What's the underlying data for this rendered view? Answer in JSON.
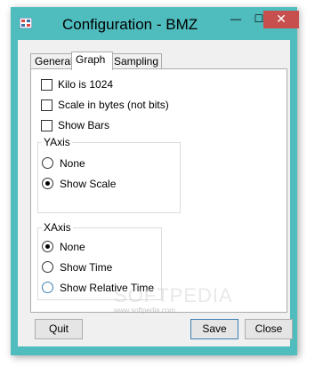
{
  "window": {
    "title": "Configuration - BMZ",
    "minimize_glyph": "—",
    "maximize_glyph": "☐",
    "close_glyph": "✕"
  },
  "tabs": [
    {
      "label": "General",
      "active": false
    },
    {
      "label": "Graph",
      "active": true
    },
    {
      "label": "Sampling",
      "active": false
    }
  ],
  "graph": {
    "checkboxes": [
      {
        "label": "Kilo is 1024",
        "checked": false
      },
      {
        "label": "Scale in bytes (not bits)",
        "checked": false
      },
      {
        "label": "Show Bars",
        "checked": false
      }
    ],
    "yaxis": {
      "title": "YAxis",
      "options": [
        {
          "label": "None",
          "checked": false
        },
        {
          "label": "Show Scale",
          "checked": true
        }
      ]
    },
    "xaxis": {
      "title": "XAxis",
      "options": [
        {
          "label": "None",
          "checked": true
        },
        {
          "label": "Show Time",
          "checked": false
        },
        {
          "label": "Show Relative Time",
          "checked": false
        }
      ]
    }
  },
  "buttons": {
    "quit": "Quit",
    "save": "Save",
    "close": "Close"
  },
  "watermark": {
    "main": "SOFTPEDIA",
    "sub": "www.softpedia.com"
  },
  "colors": {
    "window_frame": "#4fbcbd",
    "close_button": "#c7504f",
    "focus_accent": "#3c7fb1"
  },
  "icons": {
    "app": "app-icon",
    "minimize": "minimize-icon",
    "maximize": "maximize-icon",
    "close": "close-icon"
  }
}
